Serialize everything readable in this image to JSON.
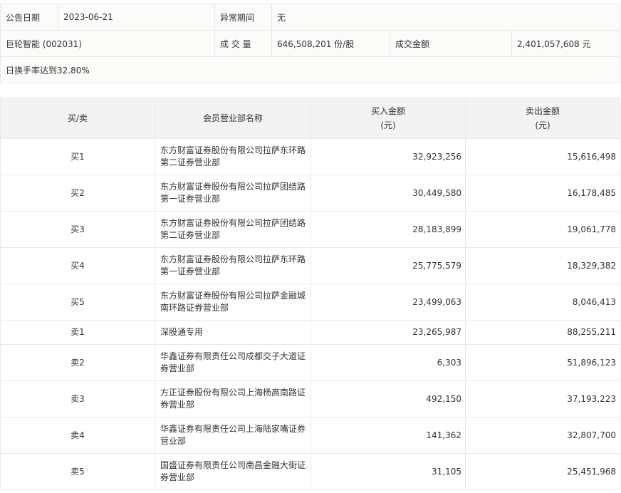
{
  "info": {
    "date_label": "公告日期",
    "date_value": "2023-06-21",
    "period_label": "异常期间",
    "period_value": "无",
    "stock": "巨轮智能 (002031)",
    "volume_label": "成 交 量",
    "volume_value": "646,508,201 份/股",
    "amount_label": "成交金额",
    "amount_value": "2,401,057,608 元",
    "reason": "日换手率达到32.80%"
  },
  "table": {
    "headers": {
      "side": "买/卖",
      "dept": "会员营业部名称",
      "buy": "买入金额",
      "buy_unit": "(元)",
      "sell": "卖出金额",
      "sell_unit": "(元)"
    },
    "rows": [
      {
        "side": "买1",
        "dept": "东方财富证券股份有限公司拉萨东环路第二证券营业部",
        "buy": "32,923,256",
        "sell": "15,616,498"
      },
      {
        "side": "买2",
        "dept": "东方财富证券股份有限公司拉萨团结路第一证券营业部",
        "buy": "30,449,580",
        "sell": "16,178,485"
      },
      {
        "side": "买3",
        "dept": "东方财富证券股份有限公司拉萨团结路第二证券营业部",
        "buy": "28,183,899",
        "sell": "19,061,778"
      },
      {
        "side": "买4",
        "dept": "东方财富证券股份有限公司拉萨东环路第一证券营业部",
        "buy": "25,775,579",
        "sell": "18,329,382"
      },
      {
        "side": "买5",
        "dept": "东方财富证券股份有限公司拉萨金融城南环路证券营业部",
        "buy": "23,499,063",
        "sell": "8,046,413"
      },
      {
        "side": "卖1",
        "dept": "深股通专用",
        "buy": "23,265,987",
        "sell": "88,255,211"
      },
      {
        "side": "卖2",
        "dept": "华鑫证券有限责任公司成都交子大道证券营业部",
        "buy": "6,303",
        "sell": "51,896,123"
      },
      {
        "side": "卖3",
        "dept": "方正证券股份有限公司上海杨高南路证券营业部",
        "buy": "492,150",
        "sell": "37,193,223"
      },
      {
        "side": "卖4",
        "dept": "华鑫证券有限责任公司上海陆家嘴证券营业部",
        "buy": "141,362",
        "sell": "32,807,700"
      },
      {
        "side": "卖5",
        "dept": "国盛证券有限责任公司南昌金融大街证券营业部",
        "buy": "31,105",
        "sell": "25,451,968"
      }
    ]
  }
}
